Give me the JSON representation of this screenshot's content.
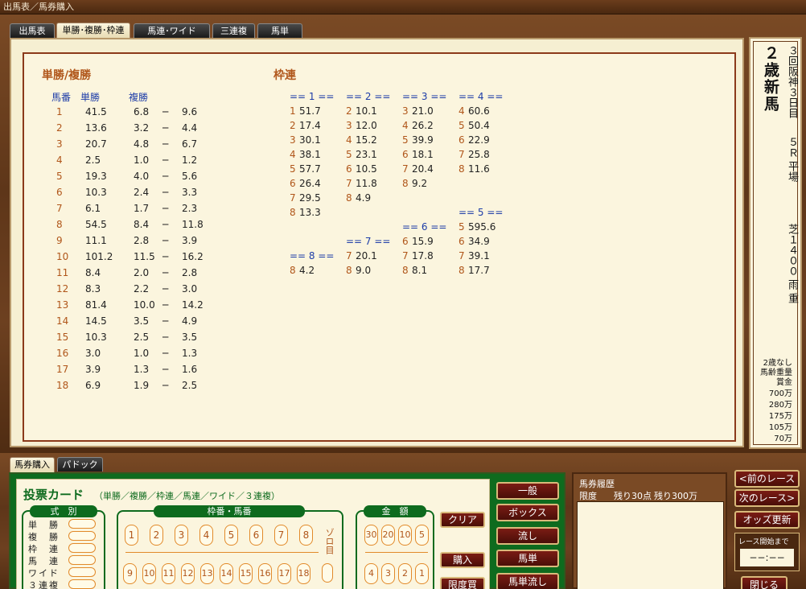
{
  "window": {
    "title": "出馬表／馬券購入"
  },
  "tabs": [
    "出馬表",
    "単勝･複勝･枠連",
    "馬連･ワイド",
    "三連複",
    "馬単"
  ],
  "win_place": {
    "title": "単勝/複勝",
    "headers": {
      "no": "馬番",
      "win": "単勝",
      "place": "複勝"
    },
    "rows": [
      {
        "no": "1",
        "win": "41.5",
        "lo": "6.8",
        "dash": "─",
        "hi": "9.6"
      },
      {
        "no": "2",
        "win": "13.6",
        "lo": "3.2",
        "dash": "─",
        "hi": "4.4"
      },
      {
        "no": "3",
        "win": "20.7",
        "lo": "4.8",
        "dash": "─",
        "hi": "6.7"
      },
      {
        "no": "4",
        "win": "2.5",
        "lo": "1.0",
        "dash": "─",
        "hi": "1.2"
      },
      {
        "no": "5",
        "win": "19.3",
        "lo": "4.0",
        "dash": "─",
        "hi": "5.6"
      },
      {
        "no": "6",
        "win": "10.3",
        "lo": "2.4",
        "dash": "─",
        "hi": "3.3"
      },
      {
        "no": "7",
        "win": "6.1",
        "lo": "1.7",
        "dash": "─",
        "hi": "2.3"
      },
      {
        "no": "8",
        "win": "54.5",
        "lo": "8.4",
        "dash": "─",
        "hi": "11.8"
      },
      {
        "no": "9",
        "win": "11.1",
        "lo": "2.8",
        "dash": "─",
        "hi": "3.9"
      },
      {
        "no": "10",
        "win": "101.2",
        "lo": "11.5",
        "dash": "─",
        "hi": "16.2"
      },
      {
        "no": "11",
        "win": "8.4",
        "lo": "2.0",
        "dash": "─",
        "hi": "2.8"
      },
      {
        "no": "12",
        "win": "8.3",
        "lo": "2.2",
        "dash": "─",
        "hi": "3.0"
      },
      {
        "no": "13",
        "win": "81.4",
        "lo": "10.0",
        "dash": "─",
        "hi": "14.2"
      },
      {
        "no": "14",
        "win": "14.5",
        "lo": "3.5",
        "dash": "─",
        "hi": "4.9"
      },
      {
        "no": "15",
        "win": "10.3",
        "lo": "2.5",
        "dash": "─",
        "hi": "3.5"
      },
      {
        "no": "16",
        "win": "3.0",
        "lo": "1.0",
        "dash": "─",
        "hi": "1.3"
      },
      {
        "no": "17",
        "win": "3.9",
        "lo": "1.3",
        "dash": "─",
        "hi": "1.6"
      },
      {
        "no": "18",
        "win": "6.9",
        "lo": "1.9",
        "dash": "─",
        "hi": "2.5"
      }
    ]
  },
  "bracket": {
    "title": "枠連",
    "headers": [
      "== 1 ==",
      "== 2 ==",
      "== 3 ==",
      "== 4 ==",
      "== 5 ==",
      "== 6 ==",
      "== 7 ==",
      "== 8 =="
    ],
    "col1": [
      [
        "1",
        "51.7"
      ],
      [
        "2",
        "17.4"
      ],
      [
        "3",
        "30.1"
      ],
      [
        "4",
        "38.1"
      ],
      [
        "5",
        "57.7"
      ],
      [
        "6",
        "26.4"
      ],
      [
        "7",
        "29.5"
      ],
      [
        "8",
        "13.3"
      ]
    ],
    "col2": [
      [
        "2",
        "10.1"
      ],
      [
        "3",
        "12.0"
      ],
      [
        "4",
        "15.2"
      ],
      [
        "5",
        "23.1"
      ],
      [
        "6",
        "10.5"
      ],
      [
        "7",
        "11.8"
      ],
      [
        "8",
        "4.9"
      ]
    ],
    "col3": [
      [
        "3",
        "21.0"
      ],
      [
        "4",
        "26.2"
      ],
      [
        "5",
        "39.9"
      ],
      [
        "6",
        "18.1"
      ],
      [
        "7",
        "20.4"
      ],
      [
        "8",
        "9.2"
      ]
    ],
    "col4": [
      [
        "4",
        "60.6"
      ],
      [
        "5",
        "50.4"
      ],
      [
        "6",
        "22.9"
      ],
      [
        "7",
        "25.8"
      ],
      [
        "8",
        "11.6"
      ]
    ],
    "col4b": [
      [
        "5",
        "595.6"
      ],
      [
        "6",
        "34.9"
      ],
      [
        "7",
        "39.1"
      ],
      [
        "8",
        "17.7"
      ]
    ],
    "col3b": [
      [
        "6",
        "15.9"
      ],
      [
        "7",
        "17.8"
      ],
      [
        "8",
        "8.1"
      ]
    ],
    "col2b": [
      [
        "7",
        "20.1"
      ],
      [
        "8",
        "9.0"
      ]
    ],
    "col1b": [
      [
        "8",
        "4.2"
      ]
    ]
  },
  "race": {
    "kind": "２歳新馬",
    "meeting": "３回阪神３日目",
    "number": "５Ｒ 平場",
    "course": "芝１４００ 雨 重",
    "conditions": [
      "2歳なし",
      "馬齢重量"
    ],
    "prize_label": "賞金",
    "prizes": [
      "700万",
      "280万",
      "175万",
      "105万",
      "70万"
    ]
  },
  "bottom_tabs": [
    "馬券購入",
    "パドック"
  ],
  "card": {
    "title": "投票カード",
    "subtitle": "（単勝／複勝／枠連／馬連／ワイド／３連複）",
    "type_label": "式　別",
    "types": [
      "単　勝",
      "複　勝",
      "枠　連",
      "馬　連",
      "ワイド",
      "３連複"
    ],
    "num_label": "枠番・馬番",
    "row1": [
      "1",
      "2",
      "3",
      "4",
      "5",
      "6",
      "7",
      "8"
    ],
    "row2": [
      "9",
      "10",
      "11",
      "12",
      "13",
      "14",
      "15",
      "16",
      "17",
      "18"
    ],
    "zorome": "ゾロ目",
    "amt_label": "金　額",
    "amt_row1": [
      "30",
      "20",
      "10",
      "5"
    ],
    "amt_row2": [
      "4",
      "3",
      "2",
      "1"
    ],
    "clear": "クリア",
    "buy": "購入",
    "limit": "限度買"
  },
  "modes": [
    "一般",
    "ボックス",
    "流し",
    "馬単",
    "馬単流し"
  ],
  "history": {
    "title": "馬券履歴",
    "limit": "限度",
    "points": "残り30点",
    "amount": "残り300万"
  },
  "nav": {
    "prev": "<前のレース",
    "next": "次のレース>",
    "update": "オッズ更新",
    "until": "レース開始まで",
    "time": "−−:−−",
    "close": "閉じる"
  }
}
